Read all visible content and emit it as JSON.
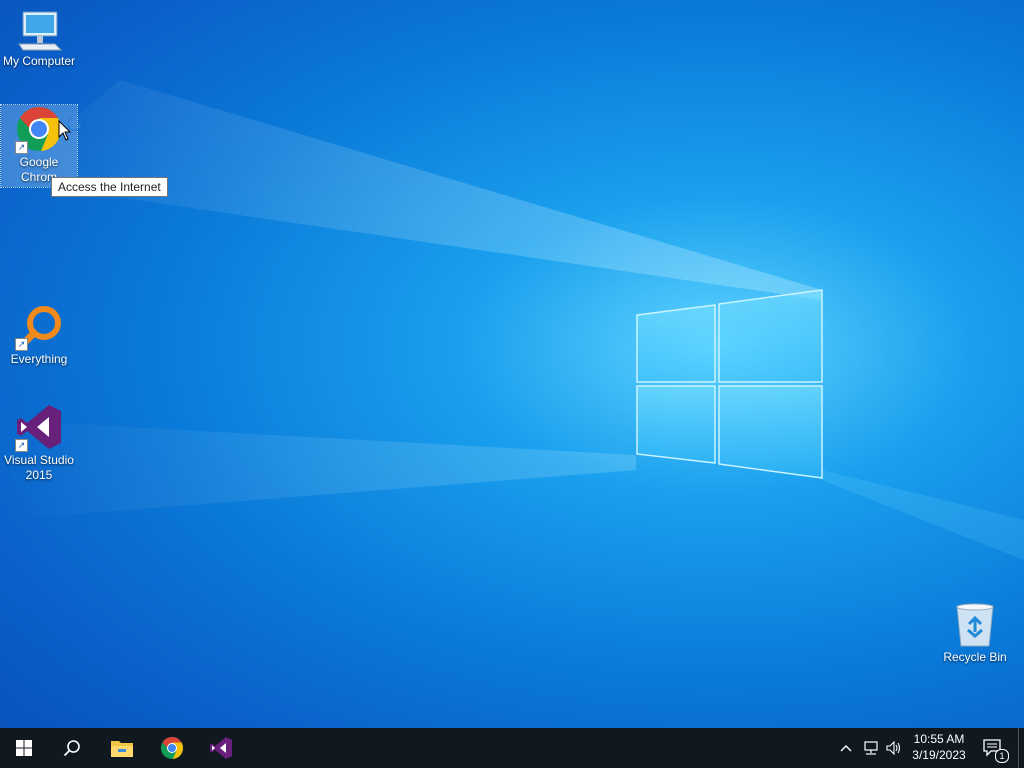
{
  "desktop": {
    "icons": [
      {
        "label": "My Computer"
      },
      {
        "label": "Google Chrome",
        "label_visible_line1": "Google",
        "label_visible_line2": "Chrom"
      },
      {
        "label": "Everything"
      },
      {
        "label": "Visual Studio 2015",
        "label_line1": "Visual Studio",
        "label_line2": "2015"
      },
      {
        "label": "Recycle Bin"
      }
    ],
    "tooltip": "Access the Internet"
  },
  "taskbar": {
    "start": "start-icon",
    "search": "search-icon",
    "pinned": [
      "file-explorer-icon",
      "chrome-icon",
      "visual-studio-icon"
    ],
    "tray": {
      "clock_time": "10:55 AM",
      "clock_date": "3/19/2023",
      "notification_count": "1"
    }
  },
  "colors": {
    "taskbar": "#101820",
    "wallpaper_accent": "#0a7ad8",
    "chrome_red": "#db4437",
    "chrome_yellow": "#f4c20d",
    "chrome_green": "#0f9d58",
    "chrome_blue": "#4285f4",
    "vs_purple": "#68217a",
    "everything_orange": "#f08a1c"
  }
}
